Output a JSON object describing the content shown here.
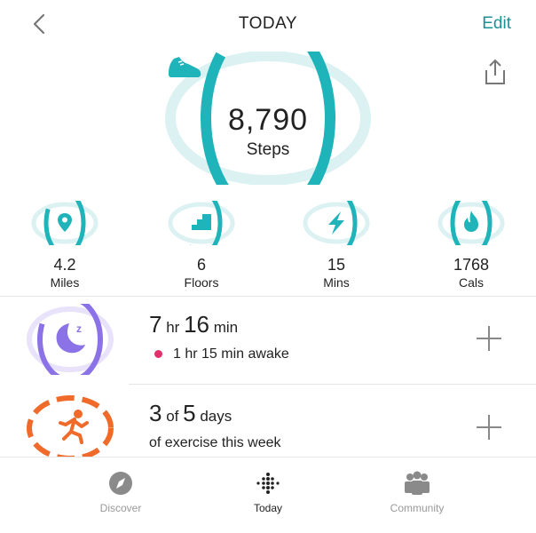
{
  "header": {
    "title": "TODAY",
    "edit_label": "Edit"
  },
  "steps": {
    "value": "8,790",
    "label": "Steps",
    "progress": 0.88
  },
  "stats": [
    {
      "value": "4.2",
      "label": "Miles",
      "icon": "location-pin-icon",
      "progress": 0.84
    },
    {
      "value": "6",
      "label": "Floors",
      "icon": "stairs-icon",
      "progress": 0.6
    },
    {
      "value": "15",
      "label": "Mins",
      "icon": "lightning-bolt-icon",
      "progress": 0.5
    },
    {
      "value": "1768",
      "label": "Cals",
      "icon": "flame-icon",
      "progress": 1.0
    }
  ],
  "sleep": {
    "hours": "7",
    "hr_unit": "hr",
    "minutes": "16",
    "min_unit": "min",
    "awake_text": "1 hr 15 min awake"
  },
  "exercise": {
    "done": "3",
    "of_text": "of",
    "goal": "5",
    "unit": "days",
    "sub_text": "of exercise this week"
  },
  "tabs": [
    {
      "label": "Discover",
      "icon": "compass-icon",
      "active": false
    },
    {
      "label": "Today",
      "icon": "fitbit-dots-icon",
      "active": true
    },
    {
      "label": "Community",
      "icon": "people-icon",
      "active": false
    }
  ],
  "colors": {
    "teal": "#1fb3ba",
    "teal_light": "#dbf1f2",
    "purple": "#8b72e6",
    "orange": "#f06a2a",
    "pink_dot": "#e2306c"
  }
}
